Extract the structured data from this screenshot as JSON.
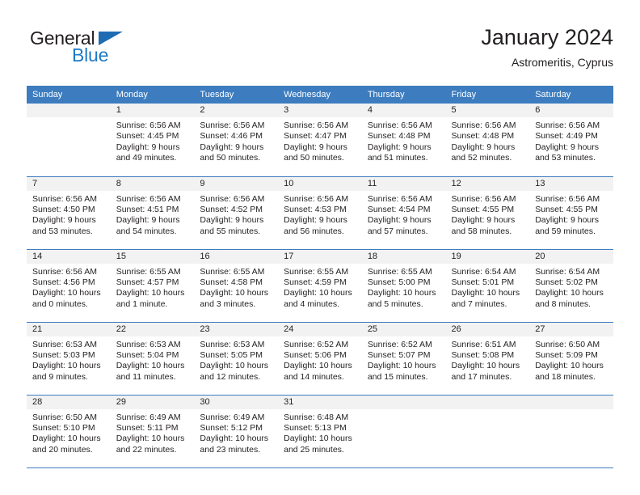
{
  "brand": {
    "word_one": "General",
    "word_two": "Blue",
    "triangle_color": "#1f6cb4",
    "blue_color": "#1f7ac4",
    "dark_color": "#231f20"
  },
  "header": {
    "title": "January 2024",
    "location": "Astromeritis, Cyprus"
  },
  "theme": {
    "header_bg": "#3c7cbf",
    "header_text": "#ffffff",
    "daynum_band_bg": "#f2f2f2",
    "cell_bg": "#ffffff",
    "grid_line": "#3c7cbf",
    "body_text": "#231f20"
  },
  "weekday_headers": [
    "Sunday",
    "Monday",
    "Tuesday",
    "Wednesday",
    "Thursday",
    "Friday",
    "Saturday"
  ],
  "weeks": [
    [
      {
        "day": "",
        "sunrise": "",
        "sunset": "",
        "daylight_1": "",
        "daylight_2": "",
        "empty": true
      },
      {
        "day": "1",
        "sunrise": "Sunrise: 6:56 AM",
        "sunset": "Sunset: 4:45 PM",
        "daylight_1": "Daylight: 9 hours",
        "daylight_2": "and 49 minutes."
      },
      {
        "day": "2",
        "sunrise": "Sunrise: 6:56 AM",
        "sunset": "Sunset: 4:46 PM",
        "daylight_1": "Daylight: 9 hours",
        "daylight_2": "and 50 minutes."
      },
      {
        "day": "3",
        "sunrise": "Sunrise: 6:56 AM",
        "sunset": "Sunset: 4:47 PM",
        "daylight_1": "Daylight: 9 hours",
        "daylight_2": "and 50 minutes."
      },
      {
        "day": "4",
        "sunrise": "Sunrise: 6:56 AM",
        "sunset": "Sunset: 4:48 PM",
        "daylight_1": "Daylight: 9 hours",
        "daylight_2": "and 51 minutes."
      },
      {
        "day": "5",
        "sunrise": "Sunrise: 6:56 AM",
        "sunset": "Sunset: 4:48 PM",
        "daylight_1": "Daylight: 9 hours",
        "daylight_2": "and 52 minutes."
      },
      {
        "day": "6",
        "sunrise": "Sunrise: 6:56 AM",
        "sunset": "Sunset: 4:49 PM",
        "daylight_1": "Daylight: 9 hours",
        "daylight_2": "and 53 minutes."
      }
    ],
    [
      {
        "day": "7",
        "sunrise": "Sunrise: 6:56 AM",
        "sunset": "Sunset: 4:50 PM",
        "daylight_1": "Daylight: 9 hours",
        "daylight_2": "and 53 minutes."
      },
      {
        "day": "8",
        "sunrise": "Sunrise: 6:56 AM",
        "sunset": "Sunset: 4:51 PM",
        "daylight_1": "Daylight: 9 hours",
        "daylight_2": "and 54 minutes."
      },
      {
        "day": "9",
        "sunrise": "Sunrise: 6:56 AM",
        "sunset": "Sunset: 4:52 PM",
        "daylight_1": "Daylight: 9 hours",
        "daylight_2": "and 55 minutes."
      },
      {
        "day": "10",
        "sunrise": "Sunrise: 6:56 AM",
        "sunset": "Sunset: 4:53 PM",
        "daylight_1": "Daylight: 9 hours",
        "daylight_2": "and 56 minutes."
      },
      {
        "day": "11",
        "sunrise": "Sunrise: 6:56 AM",
        "sunset": "Sunset: 4:54 PM",
        "daylight_1": "Daylight: 9 hours",
        "daylight_2": "and 57 minutes."
      },
      {
        "day": "12",
        "sunrise": "Sunrise: 6:56 AM",
        "sunset": "Sunset: 4:55 PM",
        "daylight_1": "Daylight: 9 hours",
        "daylight_2": "and 58 minutes."
      },
      {
        "day": "13",
        "sunrise": "Sunrise: 6:56 AM",
        "sunset": "Sunset: 4:55 PM",
        "daylight_1": "Daylight: 9 hours",
        "daylight_2": "and 59 minutes."
      }
    ],
    [
      {
        "day": "14",
        "sunrise": "Sunrise: 6:56 AM",
        "sunset": "Sunset: 4:56 PM",
        "daylight_1": "Daylight: 10 hours",
        "daylight_2": "and 0 minutes."
      },
      {
        "day": "15",
        "sunrise": "Sunrise: 6:55 AM",
        "sunset": "Sunset: 4:57 PM",
        "daylight_1": "Daylight: 10 hours",
        "daylight_2": "and 1 minute."
      },
      {
        "day": "16",
        "sunrise": "Sunrise: 6:55 AM",
        "sunset": "Sunset: 4:58 PM",
        "daylight_1": "Daylight: 10 hours",
        "daylight_2": "and 3 minutes."
      },
      {
        "day": "17",
        "sunrise": "Sunrise: 6:55 AM",
        "sunset": "Sunset: 4:59 PM",
        "daylight_1": "Daylight: 10 hours",
        "daylight_2": "and 4 minutes."
      },
      {
        "day": "18",
        "sunrise": "Sunrise: 6:55 AM",
        "sunset": "Sunset: 5:00 PM",
        "daylight_1": "Daylight: 10 hours",
        "daylight_2": "and 5 minutes."
      },
      {
        "day": "19",
        "sunrise": "Sunrise: 6:54 AM",
        "sunset": "Sunset: 5:01 PM",
        "daylight_1": "Daylight: 10 hours",
        "daylight_2": "and 7 minutes."
      },
      {
        "day": "20",
        "sunrise": "Sunrise: 6:54 AM",
        "sunset": "Sunset: 5:02 PM",
        "daylight_1": "Daylight: 10 hours",
        "daylight_2": "and 8 minutes."
      }
    ],
    [
      {
        "day": "21",
        "sunrise": "Sunrise: 6:53 AM",
        "sunset": "Sunset: 5:03 PM",
        "daylight_1": "Daylight: 10 hours",
        "daylight_2": "and 9 minutes."
      },
      {
        "day": "22",
        "sunrise": "Sunrise: 6:53 AM",
        "sunset": "Sunset: 5:04 PM",
        "daylight_1": "Daylight: 10 hours",
        "daylight_2": "and 11 minutes."
      },
      {
        "day": "23",
        "sunrise": "Sunrise: 6:53 AM",
        "sunset": "Sunset: 5:05 PM",
        "daylight_1": "Daylight: 10 hours",
        "daylight_2": "and 12 minutes."
      },
      {
        "day": "24",
        "sunrise": "Sunrise: 6:52 AM",
        "sunset": "Sunset: 5:06 PM",
        "daylight_1": "Daylight: 10 hours",
        "daylight_2": "and 14 minutes."
      },
      {
        "day": "25",
        "sunrise": "Sunrise: 6:52 AM",
        "sunset": "Sunset: 5:07 PM",
        "daylight_1": "Daylight: 10 hours",
        "daylight_2": "and 15 minutes."
      },
      {
        "day": "26",
        "sunrise": "Sunrise: 6:51 AM",
        "sunset": "Sunset: 5:08 PM",
        "daylight_1": "Daylight: 10 hours",
        "daylight_2": "and 17 minutes."
      },
      {
        "day": "27",
        "sunrise": "Sunrise: 6:50 AM",
        "sunset": "Sunset: 5:09 PM",
        "daylight_1": "Daylight: 10 hours",
        "daylight_2": "and 18 minutes."
      }
    ],
    [
      {
        "day": "28",
        "sunrise": "Sunrise: 6:50 AM",
        "sunset": "Sunset: 5:10 PM",
        "daylight_1": "Daylight: 10 hours",
        "daylight_2": "and 20 minutes."
      },
      {
        "day": "29",
        "sunrise": "Sunrise: 6:49 AM",
        "sunset": "Sunset: 5:11 PM",
        "daylight_1": "Daylight: 10 hours",
        "daylight_2": "and 22 minutes."
      },
      {
        "day": "30",
        "sunrise": "Sunrise: 6:49 AM",
        "sunset": "Sunset: 5:12 PM",
        "daylight_1": "Daylight: 10 hours",
        "daylight_2": "and 23 minutes."
      },
      {
        "day": "31",
        "sunrise": "Sunrise: 6:48 AM",
        "sunset": "Sunset: 5:13 PM",
        "daylight_1": "Daylight: 10 hours",
        "daylight_2": "and 25 minutes."
      },
      {
        "day": "",
        "sunrise": "",
        "sunset": "",
        "daylight_1": "",
        "daylight_2": "",
        "empty": true
      },
      {
        "day": "",
        "sunrise": "",
        "sunset": "",
        "daylight_1": "",
        "daylight_2": "",
        "empty": true
      },
      {
        "day": "",
        "sunrise": "",
        "sunset": "",
        "daylight_1": "",
        "daylight_2": "",
        "empty": true
      }
    ]
  ]
}
